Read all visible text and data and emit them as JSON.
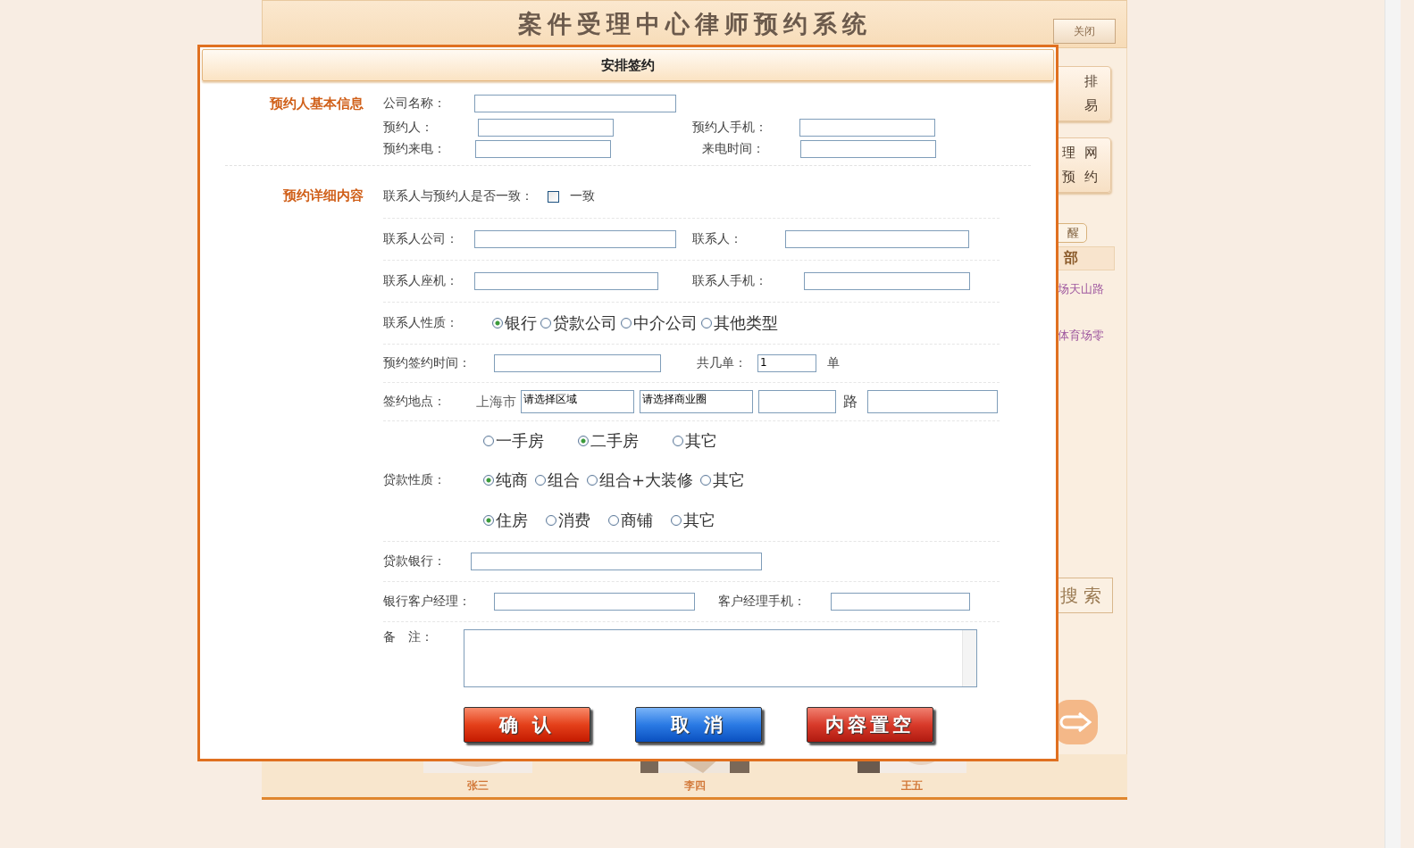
{
  "page": {
    "title": "案件受理中心律师预约系统",
    "close_button": "关闭"
  },
  "side": {
    "cards": [
      {
        "lines": [
          "排",
          "易"
        ]
      },
      {
        "lines": [
          "理  网",
          "预  约"
        ]
      }
    ],
    "reminder": "醒",
    "department": "部",
    "links": [
      "场天山路",
      "体育场零"
    ],
    "search": "搜 索"
  },
  "staff": [
    "张三",
    "李四",
    "王五"
  ],
  "dialog": {
    "title": "安排签约",
    "basic": {
      "heading": "预约人基本信息",
      "company": {
        "label": "公司名称："
      },
      "person": {
        "label": "预约人："
      },
      "person_mobile": {
        "label": "预约人手机："
      },
      "call_phone": {
        "label": "预约来电："
      },
      "call_time": {
        "label": "来电时间："
      }
    },
    "detail": {
      "heading": "预约详细内容",
      "same_contact": {
        "label": "联系人与预约人是否一致：",
        "option": "一致",
        "checked": false
      },
      "contact_company": {
        "label": "联系人公司："
      },
      "contact": {
        "label": "联系人："
      },
      "contact_phone": {
        "label": "联系人座机："
      },
      "contact_mobile": {
        "label": "联系人手机："
      },
      "contact_type": {
        "label": "联系人性质：",
        "options": [
          {
            "label": "银行",
            "selected": true
          },
          {
            "label": "贷款公司",
            "selected": false
          },
          {
            "label": "中介公司",
            "selected": false
          },
          {
            "label": "其他类型",
            "selected": false
          }
        ]
      },
      "sign_time": {
        "label": "预约签约时间："
      },
      "count": {
        "label": "共几单：",
        "value": "1",
        "unit": "单"
      },
      "place": {
        "label": "签约地点：",
        "city": "上海市",
        "district": "请选择区域",
        "area": "请选择商业圈",
        "road": "路"
      },
      "house_type": {
        "options": [
          {
            "label": "一手房",
            "selected": false
          },
          {
            "label": "二手房",
            "selected": true
          },
          {
            "label": "其它",
            "selected": false
          }
        ]
      },
      "loan_type": {
        "label": "贷款性质：",
        "options": [
          {
            "label": "纯商",
            "selected": true
          },
          {
            "label": "组合",
            "selected": false
          },
          {
            "label": "组合+大装修",
            "selected": false
          },
          {
            "label": "其它",
            "selected": false
          }
        ]
      },
      "usage": {
        "options": [
          {
            "label": "住房",
            "selected": true
          },
          {
            "label": "消费",
            "selected": false
          },
          {
            "label": "商铺",
            "selected": false
          },
          {
            "label": "其它",
            "selected": false
          }
        ]
      },
      "bank": {
        "label": "贷款银行："
      },
      "manager": {
        "label": "银行客户经理："
      },
      "manager_mobile": {
        "label": "客户经理手机："
      },
      "note": {
        "label": "备　注："
      }
    },
    "buttons": [
      {
        "label": "确 认",
        "kind": "confirm"
      },
      {
        "label": "取 消",
        "kind": "cancel"
      },
      {
        "label": "内容置空",
        "kind": "reset"
      }
    ]
  }
}
